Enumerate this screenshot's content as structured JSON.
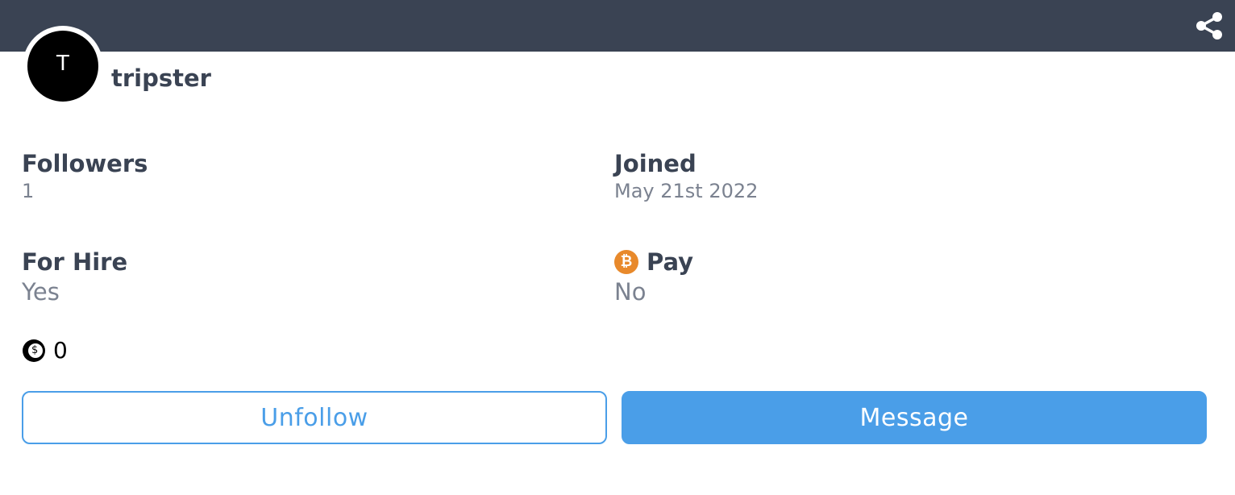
{
  "profile": {
    "avatar_initial": "T",
    "username": "tripster"
  },
  "stats": {
    "followers_label": "Followers",
    "followers_value": "1",
    "joined_label": "Joined",
    "joined_value": "May 21st 2022",
    "for_hire_label": "For Hire",
    "for_hire_value": "Yes",
    "pay_label": "Pay",
    "pay_value": "No",
    "pay_icon": "bitcoin-icon",
    "coins_value": "0",
    "coins_icon": "coin-icon"
  },
  "actions": {
    "unfollow_label": "Unfollow",
    "message_label": "Message",
    "share_icon": "share-icon"
  },
  "colors": {
    "banner": "#3a4353",
    "accent": "#4a9ee8",
    "bitcoin": "#e8892b",
    "text_dark": "#3a4353",
    "text_muted": "#7b8290"
  }
}
